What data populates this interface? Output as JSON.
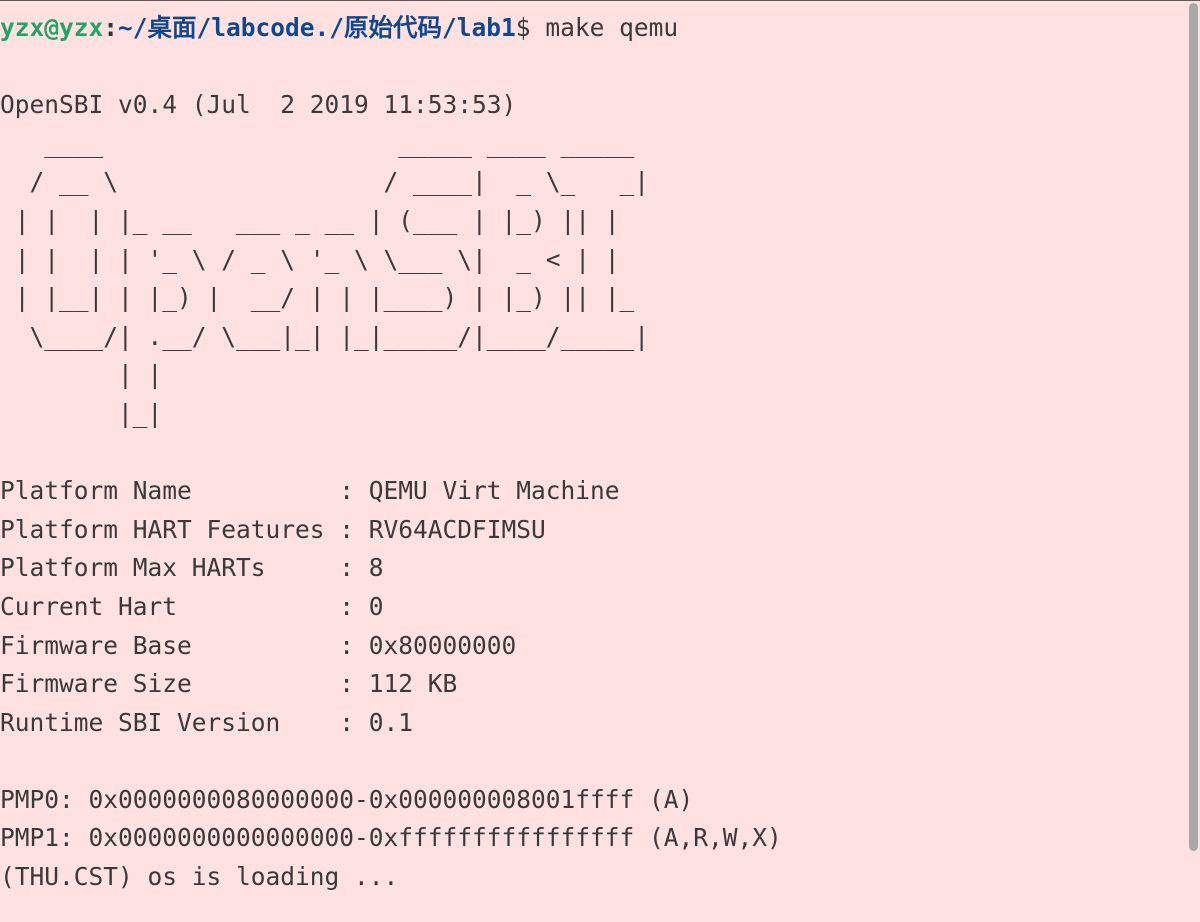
{
  "prompt": {
    "user_host": "yzx@yzx",
    "separator": ":",
    "path": "~/桌面/labcode./原始代码/lab1",
    "symbol": "$ ",
    "command": "make qemu"
  },
  "boot_header": "OpenSBI v0.4 (Jul  2 2019 11:53:53)",
  "ascii_logo": [
    "   ____                    _____ ____ _____",
    "  / __ \\                  / ____|  _ \\_   _|",
    " | |  | |_ __   ___ _ __ | (___ | |_) || |",
    " | |  | | '_ \\ / _ \\ '_ \\ \\___ \\|  _ < | |",
    " | |__| | |_) |  __/ | | |____) | |_) || |_",
    "  \\____/| .__/ \\___|_| |_|_____/|____/_____|",
    "        | |",
    "        |_|"
  ],
  "platform_info": [
    "Platform Name          : QEMU Virt Machine",
    "Platform HART Features : RV64ACDFIMSU",
    "Platform Max HARTs     : 8",
    "Current Hart           : 0",
    "Firmware Base          : 0x80000000",
    "Firmware Size          : 112 KB",
    "Runtime SBI Version    : 0.1"
  ],
  "pmp_info": [
    "PMP0: 0x0000000080000000-0x000000008001ffff (A)",
    "PMP1: 0x0000000000000000-0xffffffffffffffff (A,R,W,X)"
  ],
  "status_line": "(THU.CST) os is loading ..."
}
